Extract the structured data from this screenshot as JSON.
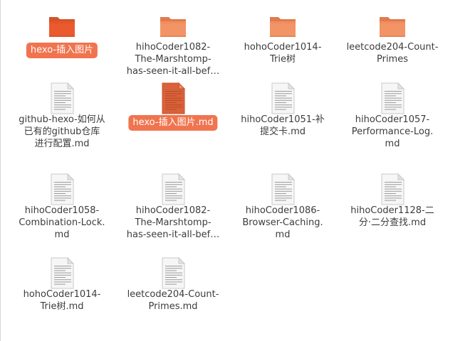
{
  "files": [
    {
      "name": "hexo-插入图片",
      "lines": [
        "hexo-插入图片"
      ],
      "type": "folder",
      "icon": "folder-icon",
      "selected": true
    },
    {
      "name": "hihoCoder1082-The-Marshtomp-has-seen-it-all-bef…",
      "lines": [
        "hihoCoder1082-",
        "The-Marshtomp-",
        "has-seen-it-all-bef…"
      ],
      "type": "folder",
      "icon": "folder-icon",
      "selected": false
    },
    {
      "name": "hohoCoder1014-Trie树",
      "lines": [
        "hohoCoder1014-",
        "Trie树"
      ],
      "type": "folder",
      "icon": "folder-icon",
      "selected": false
    },
    {
      "name": "leetcode204-Count-Primes",
      "lines": [
        "leetcode204-Count-",
        "Primes"
      ],
      "type": "folder",
      "icon": "folder-icon",
      "selected": false
    },
    {
      "name": "github-hexo-如何从已有的github仓库进行配置.md",
      "lines": [
        "github-hexo-如何从",
        "已有的github仓库",
        "进行配置.md"
      ],
      "type": "file",
      "icon": "document-icon",
      "selected": false
    },
    {
      "name": "hexo-插入图片.md",
      "lines": [
        "hexo-插入图片.md"
      ],
      "type": "file",
      "icon": "document-icon",
      "selected": true
    },
    {
      "name": "hihoCoder1051-补提交卡.md",
      "lines": [
        "hihoCoder1051-补",
        "提交卡.md"
      ],
      "type": "file",
      "icon": "document-icon",
      "selected": false
    },
    {
      "name": "hihoCoder1057-Performance-Log.md",
      "lines": [
        "hihoCoder1057-",
        "Performance-Log.",
        "md"
      ],
      "type": "file",
      "icon": "document-icon",
      "selected": false
    },
    {
      "name": "hihoCoder1058-Combination-Lock.md",
      "lines": [
        "hihoCoder1058-",
        "Combination-Lock.",
        "md"
      ],
      "type": "file",
      "icon": "document-icon",
      "selected": false
    },
    {
      "name": "hihoCoder1082-The-Marshtomp-has-seen-it-all-bef…",
      "lines": [
        "hihoCoder1082-",
        "The-Marshtomp-",
        "has-seen-it-all-bef…"
      ],
      "type": "file",
      "icon": "document-icon",
      "selected": false
    },
    {
      "name": "hihoCoder1086-Browser-Caching.md",
      "lines": [
        "hihoCoder1086-",
        "Browser-Caching.",
        "md"
      ],
      "type": "file",
      "icon": "document-icon",
      "selected": false
    },
    {
      "name": "hihoCoder1128-二分·二分查找.md",
      "lines": [
        "hihoCoder1128-二",
        "分·二分查找.md"
      ],
      "type": "file",
      "icon": "document-icon",
      "selected": false
    },
    {
      "name": "hohoCoder1014-Trie树.md",
      "lines": [
        "hohoCoder1014-",
        "Trie树.md"
      ],
      "type": "file",
      "icon": "document-icon",
      "selected": false
    },
    {
      "name": "leetcode204-Count-Primes.md",
      "lines": [
        "leetcode204-Count-",
        "Primes.md"
      ],
      "type": "file",
      "icon": "document-icon",
      "selected": false
    }
  ],
  "colors": {
    "folder_top": "#e06a3a",
    "folder_body": "#f08a5d",
    "folder_selected_body": "#e8542a",
    "selection": "#f0744f",
    "doc_paper": "#f4f4f4",
    "doc_selected_paper": "#e06a3a"
  }
}
